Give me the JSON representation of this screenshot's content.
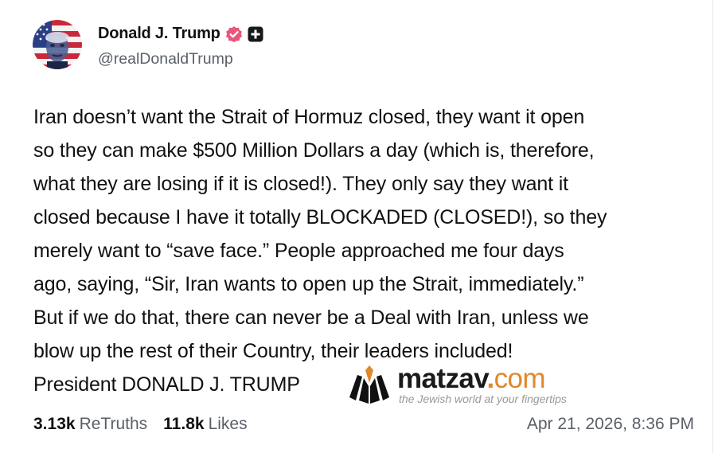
{
  "post": {
    "author": {
      "name": "Donald J. Trump",
      "handle": "@realDonaldTrump",
      "verified_icon": "verified-badge-icon",
      "plus_icon": "plus-badge-icon"
    },
    "body_lines": [
      "Iran doesn’t want the Strait of Hormuz closed, they want it open",
      "so they can make $500 Million Dollars a day (which is, therefore,",
      "what they are losing if it is closed!). They only say they want it",
      "closed because I have it totally BLOCKADED (CLOSED!), so they",
      "merely want to “save face.” People approached me four days",
      "ago, saying, “Sir, Iran wants to open up the Strait, immediately.”",
      "But if we do that, there can never be a Deal with Iran, unless we",
      "blow up the rest of their Country, their leaders included!",
      "President DONALD J. TRUMP"
    ],
    "retruths_count": "3.13k",
    "retruths_label": "ReTruths",
    "likes_count": "11.8k",
    "likes_label": "Likes",
    "timestamp": "Apr 21, 2026, 8:36 PM"
  },
  "watermark": {
    "brand": "matzav",
    "dot": ".",
    "tld": "com",
    "tagline": "the Jewish world at your fingertips"
  },
  "colors": {
    "verified_badge": "#e8567a",
    "secondary_text": "#5a5f69",
    "watermark_accent": "#e0882a"
  }
}
